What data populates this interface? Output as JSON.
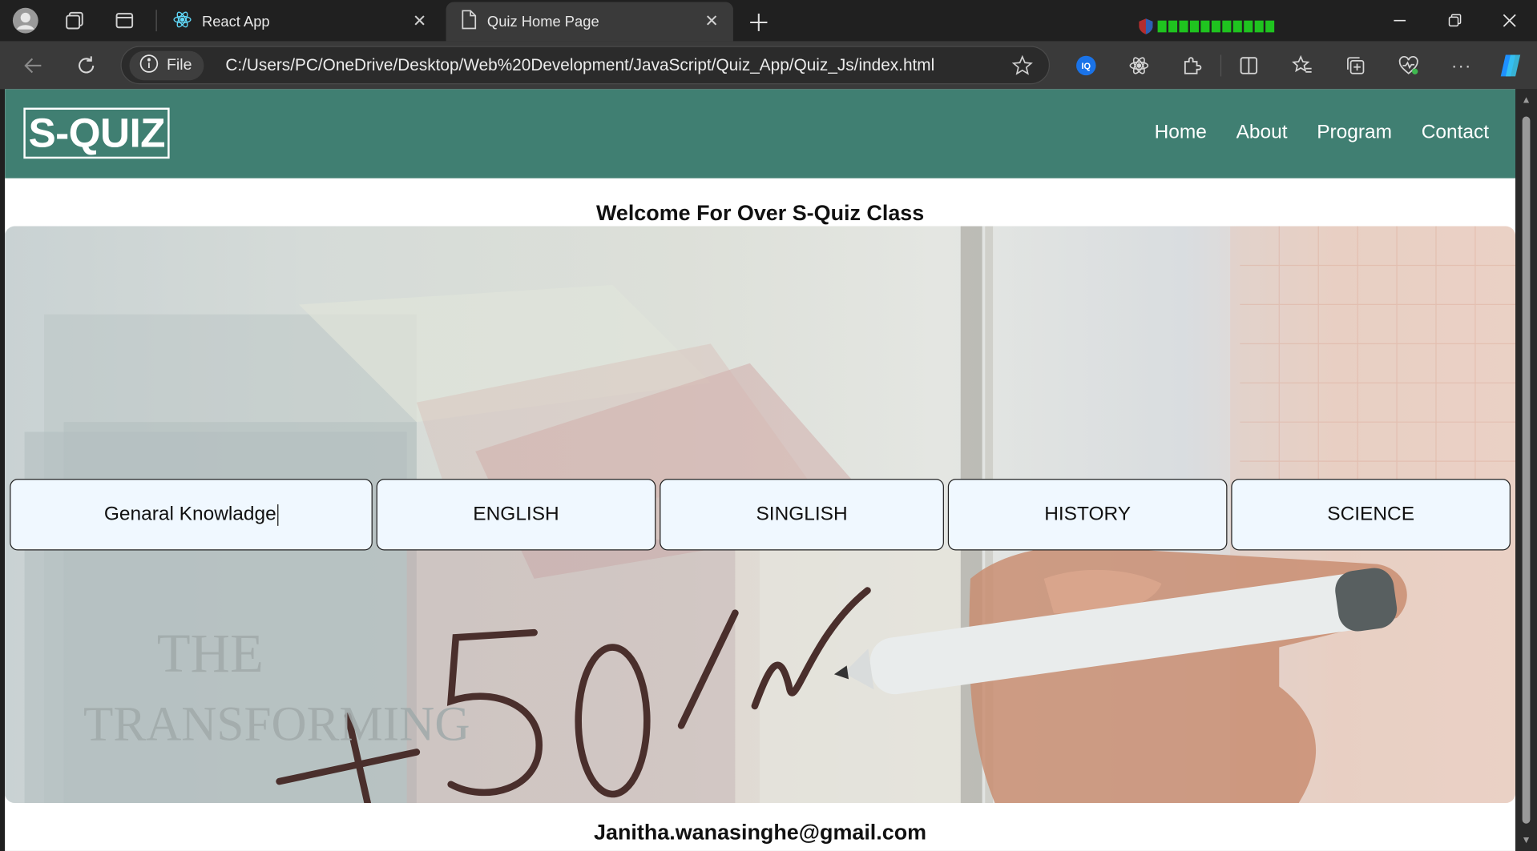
{
  "browser": {
    "tabs": [
      {
        "title": "React App",
        "active": false
      },
      {
        "title": "Quiz Home Page",
        "active": true
      }
    ],
    "address": {
      "scheme_label": "File",
      "url": "C:/Users/PC/OneDrive/Desktop/Web%20Development/JavaScript/Quiz_App/Quiz_Js/index.html"
    },
    "colors": {
      "frame": "#202020",
      "toolbar": "#3a3a3a"
    }
  },
  "site": {
    "logo": "S-QUIZ",
    "nav": [
      "Home",
      "About",
      "Program",
      "Contact"
    ],
    "welcome": "Welcome For Over S-Quiz Class",
    "subjects": [
      {
        "label": "Genaral Knowladge",
        "focused": true
      },
      {
        "label": "ENGLISH"
      },
      {
        "label": "SINGLISH"
      },
      {
        "label": "HISTORY"
      },
      {
        "label": "SCIENCE"
      }
    ],
    "footer_email": "Janitha.wanasinghe@gmail.com",
    "colors": {
      "header": "#407f72",
      "button_bg": "#f0f8ff"
    }
  }
}
